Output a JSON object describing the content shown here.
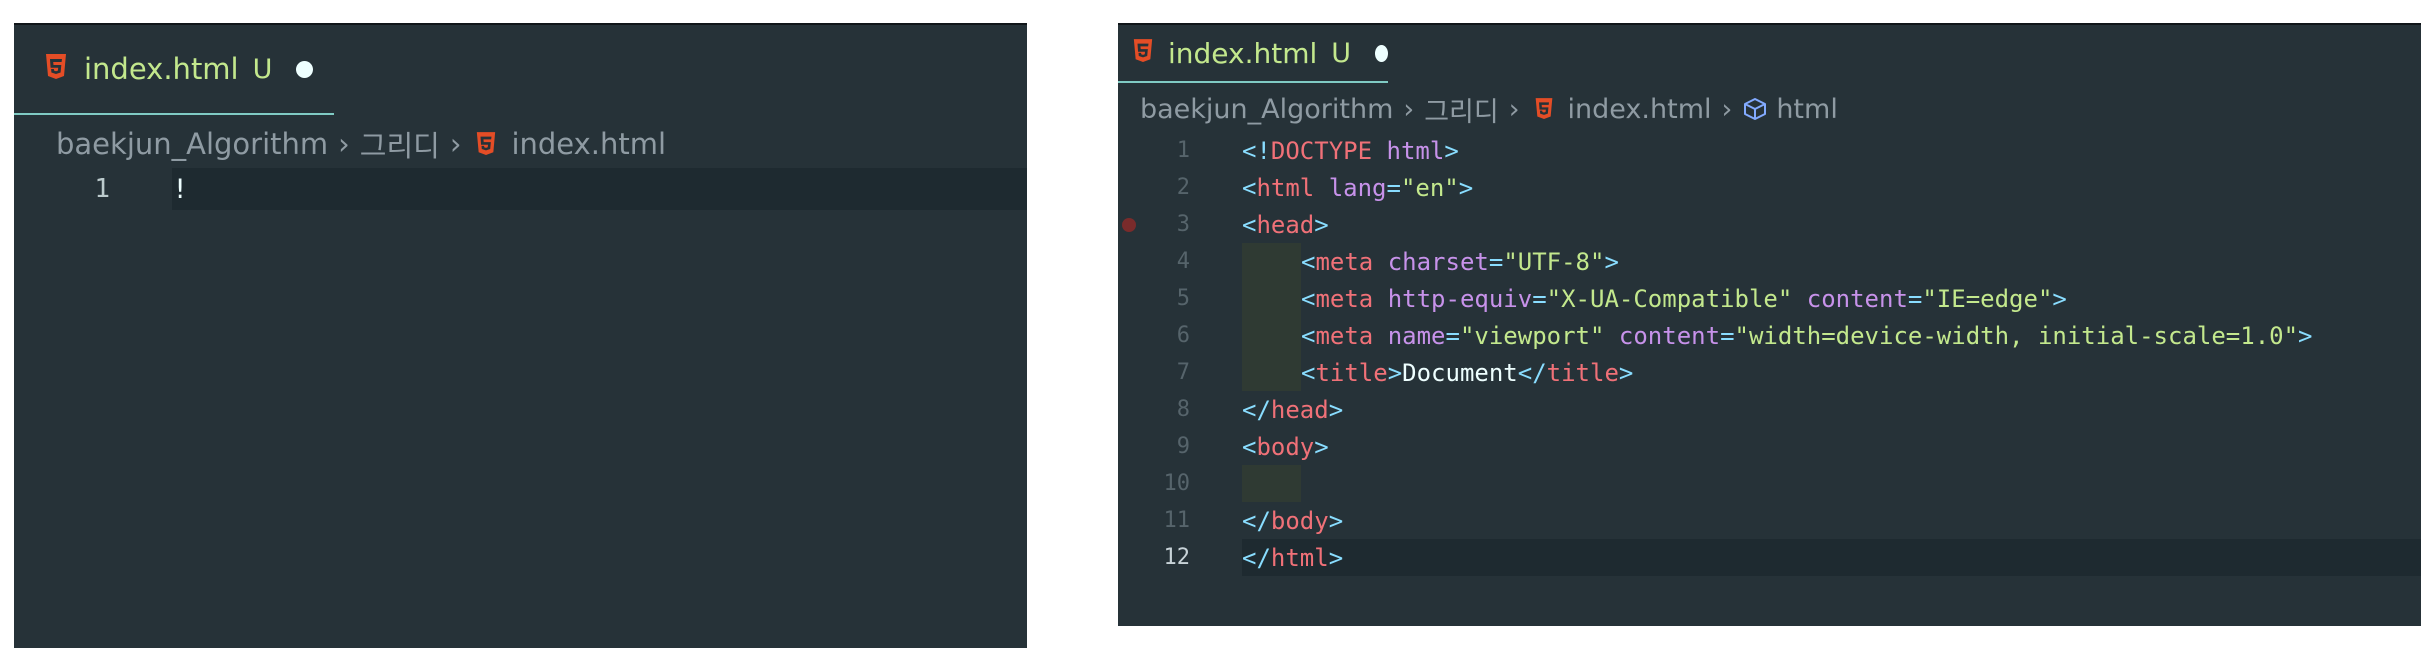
{
  "left_editor": {
    "tab": {
      "filename": "index.html",
      "status": "U"
    },
    "breadcrumb": [
      "baekjun_Algorithm",
      "그리디",
      "index.html"
    ],
    "lines": [
      {
        "number": "1",
        "text": "!"
      }
    ]
  },
  "right_editor": {
    "tab": {
      "filename": "index.html",
      "status": "U"
    },
    "breadcrumb": [
      "baekjun_Algorithm",
      "그리디",
      "index.html",
      "html"
    ],
    "line_numbers": [
      "1",
      "2",
      "3",
      "4",
      "5",
      "6",
      "7",
      "8",
      "9",
      "10",
      "11",
      "12"
    ],
    "code": {
      "l1_doctype": "DOCTYPE",
      "l1_html": "html",
      "l2_tag": "html",
      "l2_attr": "lang",
      "l2_val": "\"en\"",
      "l3_tag": "head",
      "l4_tag": "meta",
      "l4_attr": "charset",
      "l4_val": "\"UTF-8\"",
      "l5_tag": "meta",
      "l5_attr1": "http-equiv",
      "l5_val1": "\"X-UA-Compatible\"",
      "l5_attr2": "content",
      "l5_val2": "\"IE=edge\"",
      "l6_tag": "meta",
      "l6_attr1": "name",
      "l6_val1": "\"viewport\"",
      "l6_attr2": "content",
      "l6_val2": "\"width=device-width, initial-scale=1.0\"",
      "l7_tag": "title",
      "l7_text": "Document",
      "l7_close": "title",
      "l8_tag": "head",
      "l9_tag": "body",
      "l11_tag": "body",
      "l12_tag": "html"
    }
  },
  "colors": {
    "editor_background": "#263238",
    "tag": "#f07178",
    "attribute": "#c792ea",
    "string": "#c3e88d",
    "punctuation": "#89ddff",
    "html5_icon": "#e44d26"
  }
}
